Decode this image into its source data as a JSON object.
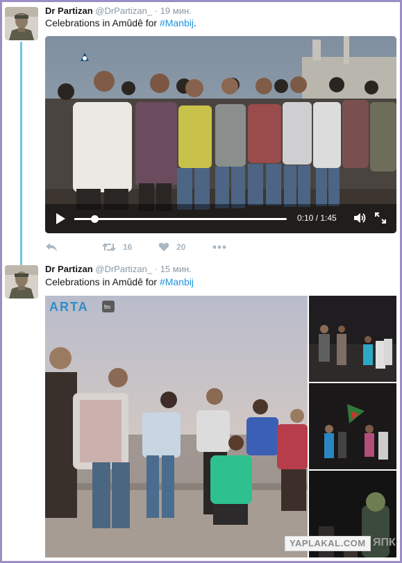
{
  "tweets": [
    {
      "author_name": "Dr Partizan",
      "handle": "@DrPartizan_",
      "separator": "·",
      "time": "19 мин.",
      "text_before": "Celebrations in Amûdê for ",
      "hashtag": "#Manbij",
      "text_after": ".",
      "video": {
        "time_display": "0:10 / 1:45",
        "progress_fraction": 0.0952,
        "channel_logo": "Ronahi"
      },
      "actions": {
        "retweets": "16",
        "likes": "20"
      }
    },
    {
      "author_name": "Dr Partizan",
      "handle": "@DrPartizan_",
      "separator": "·",
      "time": "15 мин.",
      "text_before": "Celebrations in Amûdê for ",
      "hashtag": "#Manbij",
      "text_after": "",
      "photo_logo": "ARTA",
      "photo_logo_badge": "fm"
    }
  ],
  "icons": {
    "reply": "reply-icon",
    "retweet": "retweet-icon",
    "like": "heart-icon",
    "more": "more-icon",
    "play": "play-icon",
    "volume": "volume-icon",
    "fullscreen": "fullscreen-icon"
  },
  "colors": {
    "link": "#1b95e0",
    "thread_line": "#6ec6e6",
    "frame_border": "#9b8ec4",
    "muted": "#8899a6"
  },
  "watermark": {
    "site": "YAPLAKAL.COM",
    "corner": "ЯПК"
  }
}
